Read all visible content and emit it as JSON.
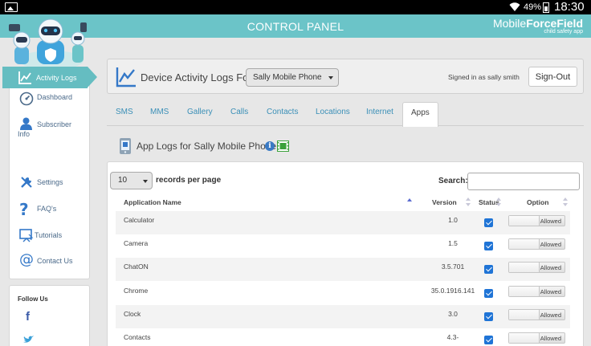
{
  "status_bar": {
    "battery": "49%",
    "time": "18:30"
  },
  "header": {
    "title": "CONTROL PANEL",
    "brand_light": "Mobile",
    "brand_bold": "ForceField",
    "tagline": "child safety app"
  },
  "sidebar": {
    "items": [
      {
        "label": "Dashboard",
        "icon": "dashboard-icon"
      },
      {
        "label": "Subscriber Info",
        "icon": "subscriber-icon"
      },
      {
        "label": "Activity Logs",
        "icon": "activity-logs-icon",
        "active": true
      },
      {
        "label": "Settings",
        "icon": "settings-icon"
      },
      {
        "label": "FAQ's",
        "icon": "faq-icon"
      },
      {
        "label": "Tutorials",
        "icon": "tutorials-icon"
      },
      {
        "label": "Contact Us",
        "icon": "contact-icon"
      }
    ],
    "follow_title": "Follow Us"
  },
  "topcard": {
    "heading": "Device Activity Logs For",
    "device": "Sally Mobile Phone",
    "signed_in": "Signed in as sally smith",
    "signout": "Sign-Out"
  },
  "tabs": [
    "SMS",
    "MMS",
    "Gallery",
    "Calls",
    "Contacts",
    "Locations",
    "Internet",
    "Apps"
  ],
  "active_tab": "Apps",
  "subheading": "App Logs for Sally Mobile Phone",
  "table": {
    "per_page_value": "10",
    "per_page_label": "records per page",
    "search_label": "Search:",
    "search_value": "",
    "columns": [
      "Application Name",
      "Version",
      "Status",
      "Option"
    ],
    "rows": [
      {
        "name": "Calculator",
        "version": "1.0",
        "status": true,
        "option": "Allowed"
      },
      {
        "name": "Camera",
        "version": "1.5",
        "status": true,
        "option": "Allowed"
      },
      {
        "name": "ChatON",
        "version": "3.5.701",
        "status": true,
        "option": "Allowed"
      },
      {
        "name": "Chrome",
        "version": "35.0.1916.141",
        "status": true,
        "option": "Allowed"
      },
      {
        "name": "Clock",
        "version": "3.0",
        "status": true,
        "option": "Allowed"
      },
      {
        "name": "Contacts",
        "version": "4.3-",
        "status": true,
        "option": "Allowed"
      }
    ]
  },
  "colors": {
    "teal": "#6bc4c8",
    "link": "#3a8fb7",
    "checkbox": "#1f74d6"
  }
}
